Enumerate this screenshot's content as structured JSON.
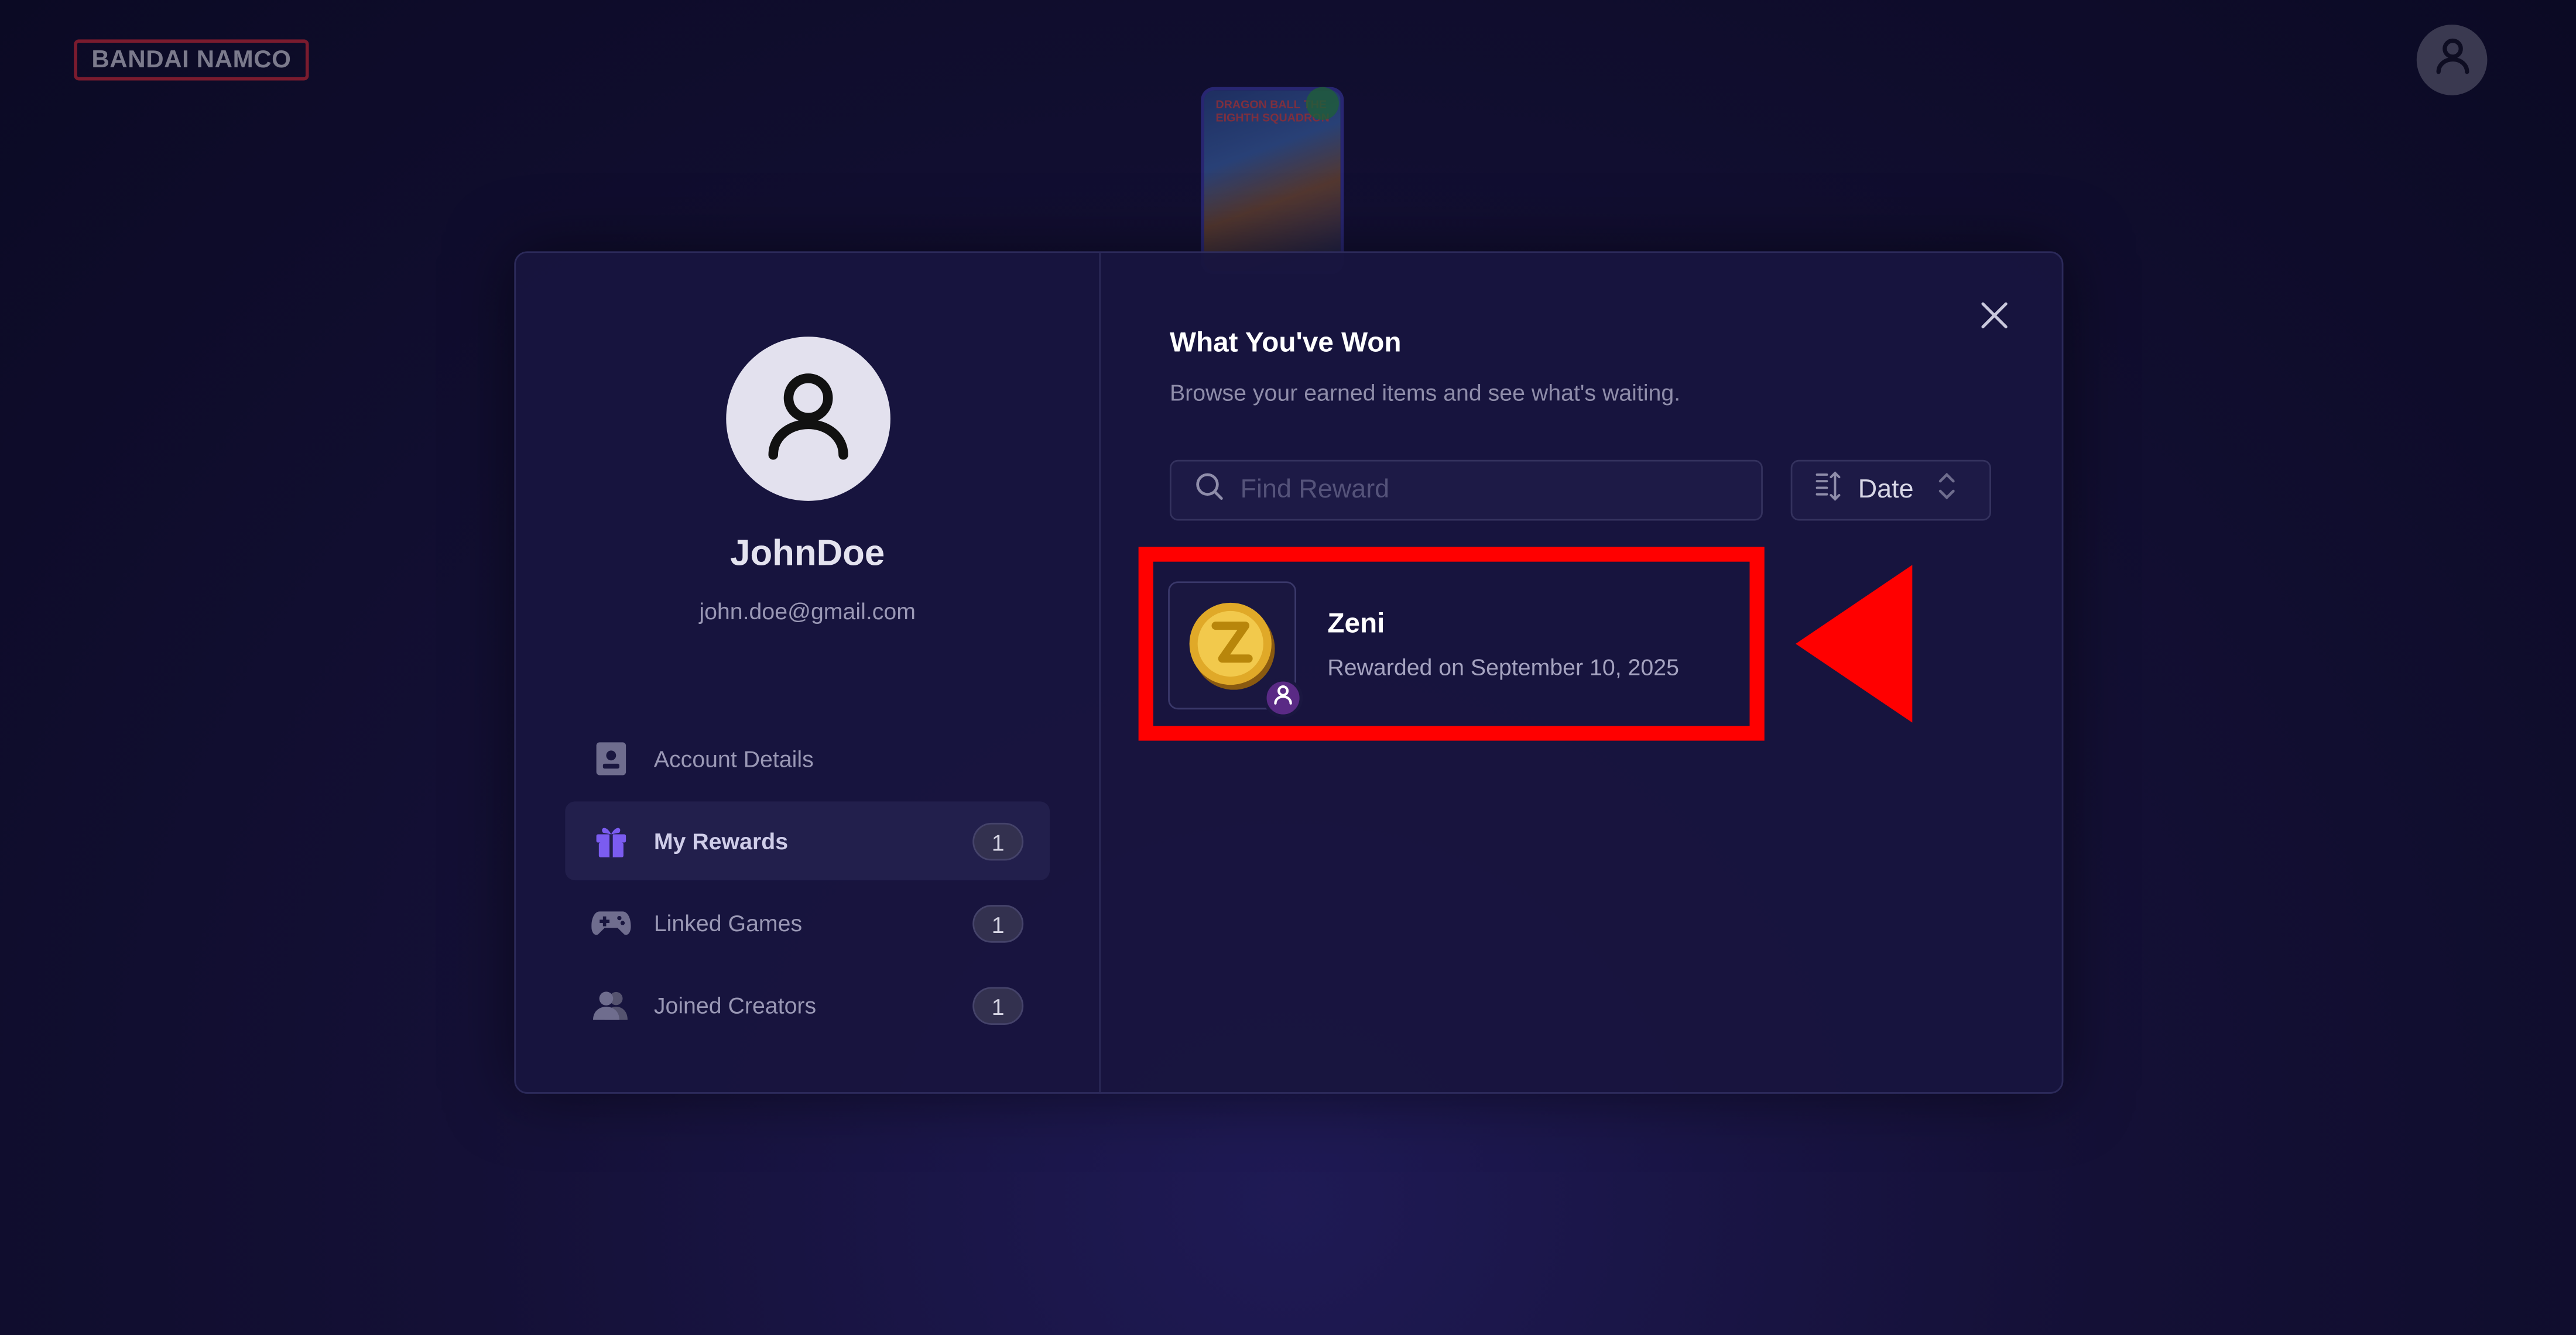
{
  "header": {
    "brand": "BANDAI NAMCO",
    "user_icon": "user-icon"
  },
  "background_card": {
    "title": "DRAGON BALL THE EIGHTH SQUADRON"
  },
  "profile": {
    "username": "JohnDoe",
    "email": "john.doe@gmail.com",
    "avatar_icon": "user-icon"
  },
  "nav": {
    "items": [
      {
        "label": "Account Details",
        "icon": "id-card-icon",
        "count": null,
        "active": false
      },
      {
        "label": "My Rewards",
        "icon": "gift-icon",
        "count": "1",
        "active": true
      },
      {
        "label": "Linked Games",
        "icon": "gamepad-icon",
        "count": "1",
        "active": false
      },
      {
        "label": "Joined Creators",
        "icon": "users-icon",
        "count": "1",
        "active": false
      }
    ]
  },
  "rewards": {
    "title": "What You've Won",
    "subtitle": "Browse your earned items and see what's waiting.",
    "search_placeholder": "Find Reward",
    "sort_label": "Date",
    "items": [
      {
        "name": "Zeni",
        "date": "Rewarded on September 10, 2025",
        "icon": "coin-icon",
        "badge_icon": "user-icon"
      }
    ]
  },
  "colors": {
    "accent": "#7b5cf0",
    "annotation": "#ff0000",
    "background": "#0b0a24"
  }
}
